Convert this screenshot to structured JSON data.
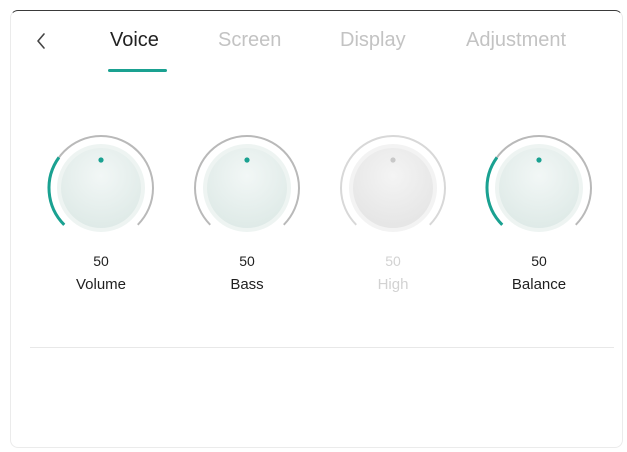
{
  "nav": {
    "back_icon": "chevron-left-icon",
    "tabs": [
      {
        "label": "Voice",
        "active": true
      },
      {
        "label": "Screen",
        "active": false
      },
      {
        "label": "Display",
        "active": false
      },
      {
        "label": "Adjustment",
        "active": false
      }
    ]
  },
  "knobs": [
    {
      "value": "50",
      "label": "Volume",
      "level": 0.3,
      "enabled": true
    },
    {
      "value": "50",
      "label": "Bass",
      "level": 0,
      "enabled": true
    },
    {
      "value": "50",
      "label": "High",
      "level": 0,
      "enabled": false
    },
    {
      "value": "50",
      "label": "Balance",
      "level": 0.3,
      "enabled": true
    }
  ],
  "colors": {
    "accent": "#1aa191",
    "track": "#b9b9b9",
    "disabled_track": "#d8d8d8",
    "active_text": "#222222",
    "inactive_text": "#c3c3c3",
    "disabled_text": "#d2d2d2"
  }
}
